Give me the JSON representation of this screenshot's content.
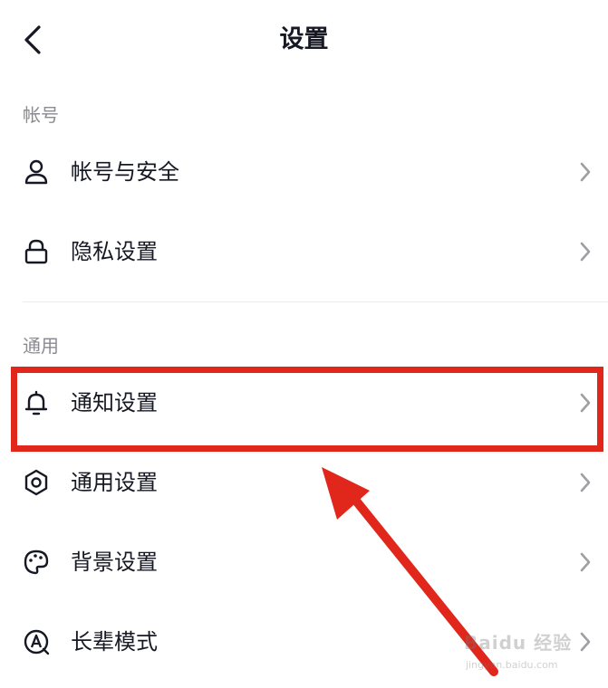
{
  "header": {
    "title": "设置",
    "back_icon": "chevron-left-icon"
  },
  "sections": [
    {
      "title": "帐号",
      "items": [
        {
          "label": "帐号与安全",
          "icon": "user-icon"
        },
        {
          "label": "隐私设置",
          "icon": "lock-icon"
        }
      ]
    },
    {
      "title": "通用",
      "items": [
        {
          "label": "通知设置",
          "icon": "bell-icon"
        },
        {
          "label": "通用设置",
          "icon": "gear-icon"
        },
        {
          "label": "背景设置",
          "icon": "palette-icon"
        },
        {
          "label": "长辈模式",
          "icon": "elder-mode-icon"
        }
      ]
    }
  ],
  "annotation": {
    "highlighted_item": "通知设置",
    "color": "#e1261c"
  },
  "watermark": {
    "brand": "Baidu 经验",
    "url": "jingyan.baidu.com"
  },
  "colors": {
    "text": "#161823",
    "section_title": "#8a8b91",
    "chevron": "#9e9ea3",
    "divider": "#ececee"
  }
}
